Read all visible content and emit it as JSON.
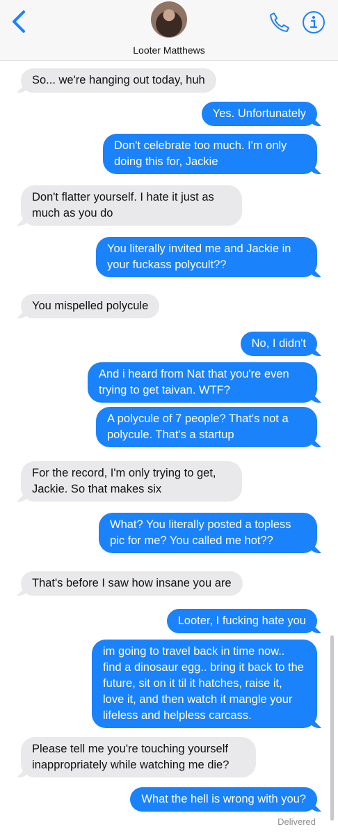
{
  "header": {
    "contact_name": "Looter Matthews",
    "back_icon": "chevron-left-icon",
    "call_icon": "phone-icon",
    "info_icon": "info-icon",
    "accent": "#1a82fb"
  },
  "messages": [
    {
      "side": "in",
      "text": "So... we're hanging out today, huh"
    },
    {
      "side": "out",
      "text": "Yes. Unfortunately"
    },
    {
      "side": "out",
      "text": "Don't celebrate too much. I'm only doing this for, Jackie"
    },
    {
      "side": "in",
      "text": "Don't flatter yourself. I hate it just as much as you do"
    },
    {
      "side": "out",
      "text": "You literally invited me and Jackie in your fuckass polycult??"
    },
    {
      "side": "in",
      "text": "You mispelled polycule"
    },
    {
      "side": "out",
      "text": "No, I didn't"
    },
    {
      "side": "out",
      "text": "And i heard from Nat that you're even trying to get taivan. WTF?"
    },
    {
      "side": "out",
      "text": "A polycule of 7 people? That's not a polycule. That's a startup"
    },
    {
      "side": "in",
      "text": "For the record, I'm only trying to get, Jackie. So that makes six"
    },
    {
      "side": "out",
      "text": "What? You literally posted a topless pic for me? You called me hot??"
    },
    {
      "side": "in",
      "text": "That's before I saw how insane you are"
    },
    {
      "side": "out",
      "text": "Looter, I fucking hate you"
    },
    {
      "side": "out",
      "text": "im going to travel back in time now.. find a dinosaur egg.. bring it back to the future, sit on it til it hatches, raise it, love it, and then watch it mangle your lifeless and helpless carcass."
    },
    {
      "side": "in",
      "text": "Please tell me you're touching yourself inappropriately while watching me die?"
    },
    {
      "side": "out",
      "text": "What the hell is wrong with you?"
    }
  ],
  "status": {
    "delivered": "Delivered"
  },
  "colors": {
    "incoming_bubble": "#e9e9eb",
    "outgoing_bubble": "#1a82fb",
    "header_bg": "#f7f7f7"
  }
}
